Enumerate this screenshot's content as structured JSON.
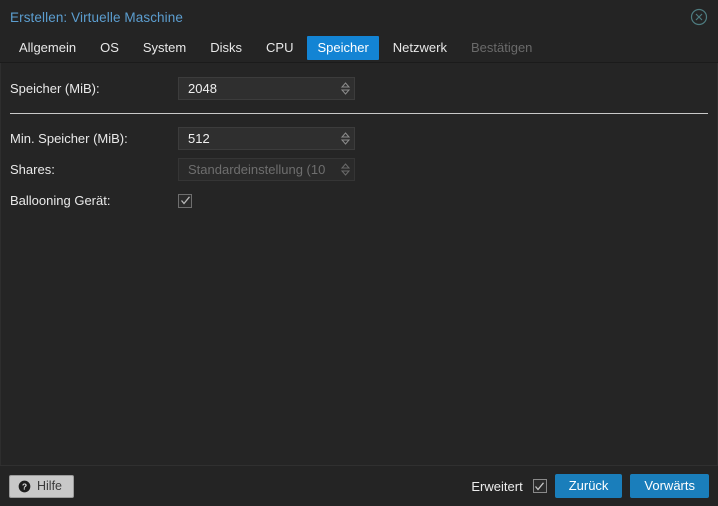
{
  "window": {
    "title": "Erstellen: Virtuelle Maschine",
    "title_color": "#5c9ed0",
    "close_icon": "close-circle-icon"
  },
  "tabs": [
    {
      "label": "Allgemein",
      "state": "normal"
    },
    {
      "label": "OS",
      "state": "normal"
    },
    {
      "label": "System",
      "state": "normal"
    },
    {
      "label": "Disks",
      "state": "normal"
    },
    {
      "label": "CPU",
      "state": "normal"
    },
    {
      "label": "Speicher",
      "state": "active"
    },
    {
      "label": "Netzwerk",
      "state": "normal"
    },
    {
      "label": "Bestätigen",
      "state": "disabled"
    }
  ],
  "form": {
    "memory": {
      "label": "Speicher (MiB):",
      "value": "2048",
      "spinner_icon": "spinner-up-down-icon"
    },
    "min_memory": {
      "label": "Min. Speicher (MiB):",
      "value": "512",
      "spinner_icon": "spinner-up-down-icon"
    },
    "shares": {
      "label": "Shares:",
      "value": "Standardeinstellung (10",
      "spinner_icon": "spinner-up-down-icon",
      "disabled": true
    },
    "ballooning": {
      "label": "Ballooning Gerät:",
      "checked": true,
      "check_icon": "checkmark-icon"
    }
  },
  "footer": {
    "help_label": "Hilfe",
    "help_icon": "question-mark-circle-icon",
    "advanced_label": "Erweitert",
    "advanced_checked": true,
    "advanced_check_icon": "checkmark-icon",
    "back_label": "Zurück",
    "next_label": "Vorwärts"
  },
  "colors": {
    "accent": "#1384d4",
    "button_blue": "#1a7ebb",
    "title_blue": "#5c9ed0",
    "window_bg": "#242424",
    "content_bg": "#252525"
  }
}
